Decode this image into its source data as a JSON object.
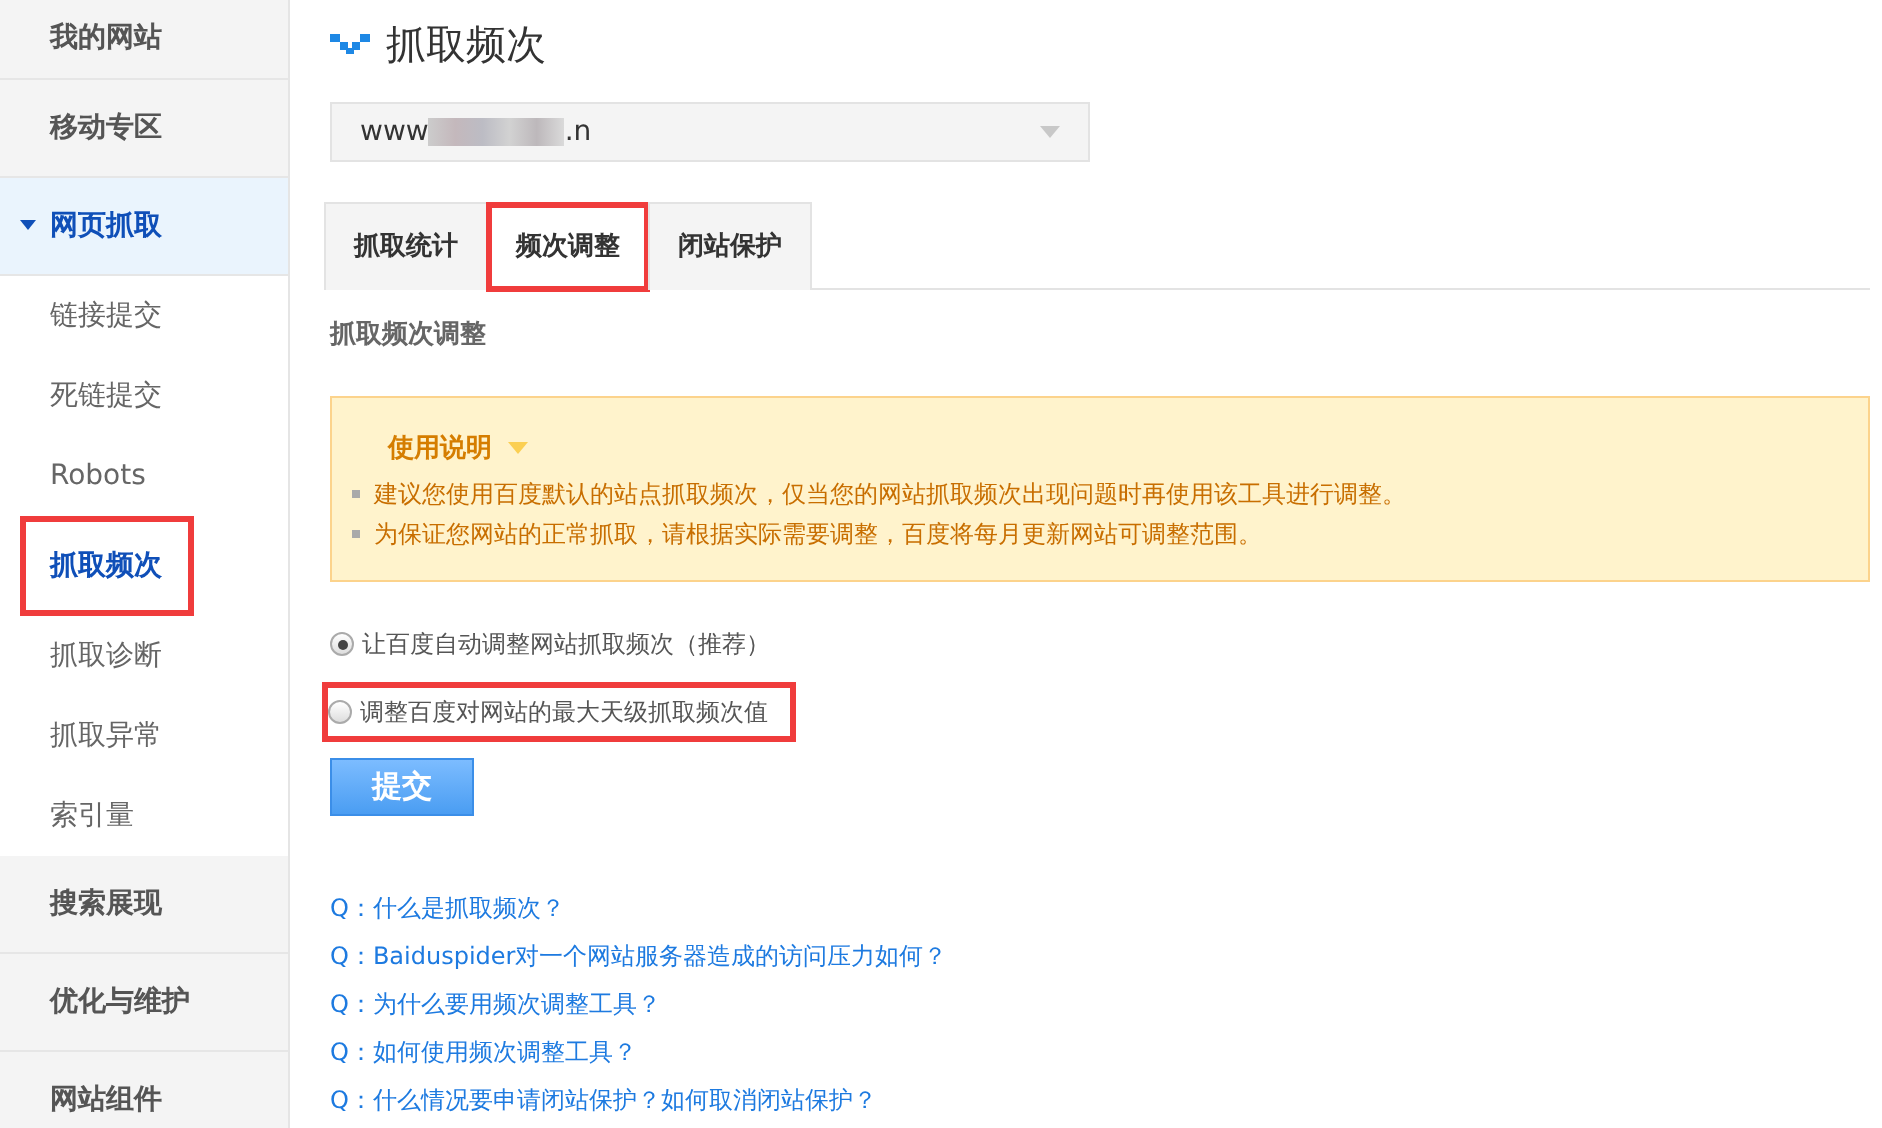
{
  "sidebar": {
    "items": [
      {
        "label": "我的网站",
        "selected": false,
        "expanded": false
      },
      {
        "label": "移动专区",
        "selected": false,
        "expanded": false
      },
      {
        "label": "网页抓取",
        "selected": true,
        "expanded": true,
        "children": [
          {
            "label": "链接提交",
            "selected": false,
            "highlighted": false
          },
          {
            "label": "死链提交",
            "selected": false,
            "highlighted": false
          },
          {
            "label": "Robots",
            "selected": false,
            "highlighted": false
          },
          {
            "label": "抓取频次",
            "selected": true,
            "highlighted": true
          },
          {
            "label": "抓取诊断",
            "selected": false,
            "highlighted": false
          },
          {
            "label": "抓取异常",
            "selected": false,
            "highlighted": false
          },
          {
            "label": "索引量",
            "selected": false,
            "highlighted": false
          }
        ]
      },
      {
        "label": "搜索展现",
        "selected": false,
        "expanded": false
      },
      {
        "label": "优化与维护",
        "selected": false,
        "expanded": false
      },
      {
        "label": "网站组件",
        "selected": false,
        "expanded": false
      }
    ]
  },
  "page_title": "抓取频次",
  "site_select": {
    "value_prefix": "www",
    "value_suffix": ".n"
  },
  "tabs": [
    {
      "label": "抓取统计",
      "selected": false,
      "highlighted": false
    },
    {
      "label": "频次调整",
      "selected": true,
      "highlighted": true
    },
    {
      "label": "闭站保护",
      "selected": false,
      "highlighted": false
    }
  ],
  "section_title": "抓取频次调整",
  "notice": {
    "title": "使用说明",
    "expanded": true,
    "items": [
      "建议您使用百度默认的站点抓取频次，仅当您的网站抓取频次出现问题时再使用该工具进行调整。",
      "为保证您网站的正常抓取，请根据实际需要调整，百度将每月更新网站可调整范围。"
    ]
  },
  "options": [
    {
      "label": "让百度自动调整网站抓取频次（推荐）",
      "selected": true,
      "highlighted": false
    },
    {
      "label": "调整百度对网站的最大天级抓取频次值",
      "selected": false,
      "highlighted": true
    }
  ],
  "submit_button": "提交",
  "faq_links": [
    "Q：什么是抓取频次？",
    "Q：Baiduspider对一个网站服务器造成的访问压力如何？",
    "Q：为什么要用频次调整工具？",
    "Q：如何使用频次调整工具？",
    "Q：什么情况要申请闭站保护？如何取消闭站保护？"
  ]
}
